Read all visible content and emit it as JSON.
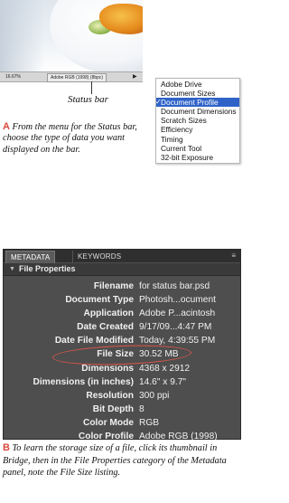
{
  "figure_a": {
    "status_bar": {
      "zoom": "16.67%",
      "info": "Adobe RGB (1998) (8bpc)"
    },
    "status_bar_label": "Status bar",
    "menu_items": [
      "Adobe Drive",
      "Document Sizes",
      "Document Profile",
      "Document Dimensions",
      "Scratch Sizes",
      "Efficiency",
      "Timing",
      "Current Tool",
      "32-bit Exposure"
    ],
    "selected_item": "Document Profile",
    "caption_letter": "A",
    "caption_text": "From the menu for the Status bar, choose the type of data you want displayed on the bar."
  },
  "figure_b": {
    "tabs": [
      "METADATA",
      "KEYWORDS"
    ],
    "section_title": "File Properties",
    "rows": [
      {
        "key": "Filename",
        "value": "for status bar.psd"
      },
      {
        "key": "Document Type",
        "value": "Photosh...ocument"
      },
      {
        "key": "Application",
        "value": "Adobe P...acintosh"
      },
      {
        "key": "Date Created",
        "value": "9/17/09...4:47 PM"
      },
      {
        "key": "Date File Modified",
        "value": "Today, 4:39:55 PM"
      },
      {
        "key": "File Size",
        "value": "30.52 MB"
      },
      {
        "key": "Dimensions",
        "value": "4368 x 2912"
      },
      {
        "key": "Dimensions (in inches)",
        "value": "14.6\" x 9.7\""
      },
      {
        "key": "Resolution",
        "value": "300 ppi"
      },
      {
        "key": "Bit Depth",
        "value": "8"
      },
      {
        "key": "Color Mode",
        "value": "RGB"
      },
      {
        "key": "Color Profile",
        "value": "Adobe RGB (1998)"
      }
    ],
    "highlighted_row": "File Size",
    "caption_letter": "B",
    "caption_text": "To learn the storage size of a file, click its thumbnail in Bridge, then in the File Properties category of the Metadata panel, note the File Size listing."
  }
}
